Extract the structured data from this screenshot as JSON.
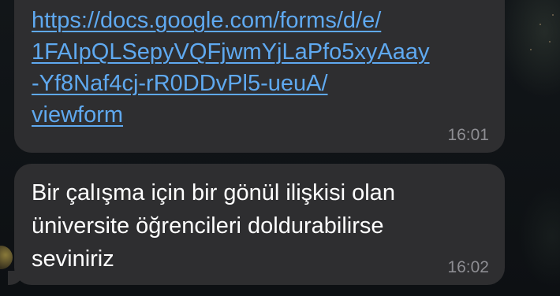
{
  "messages": [
    {
      "link_lines": [
        "https://docs.google.com/forms/d/e/",
        "1FAIpQLSepyVQFjwmYjLaPfo5xyAaay",
        "-Yf8Naf4cj-rR0DDvPl5-ueuA/",
        "viewform"
      ],
      "time": "16:01"
    },
    {
      "text_lines": [
        "Bir çalışma için bir gönül ilişkisi olan",
        "üniversite öğrencileri doldurabilirse",
        "seviniriz"
      ],
      "time": "16:02"
    }
  ],
  "colors": {
    "bubble": "#2e2e30",
    "link": "#5fa9f0",
    "timestamp": "#8e8e93",
    "background": "#0e1216"
  }
}
